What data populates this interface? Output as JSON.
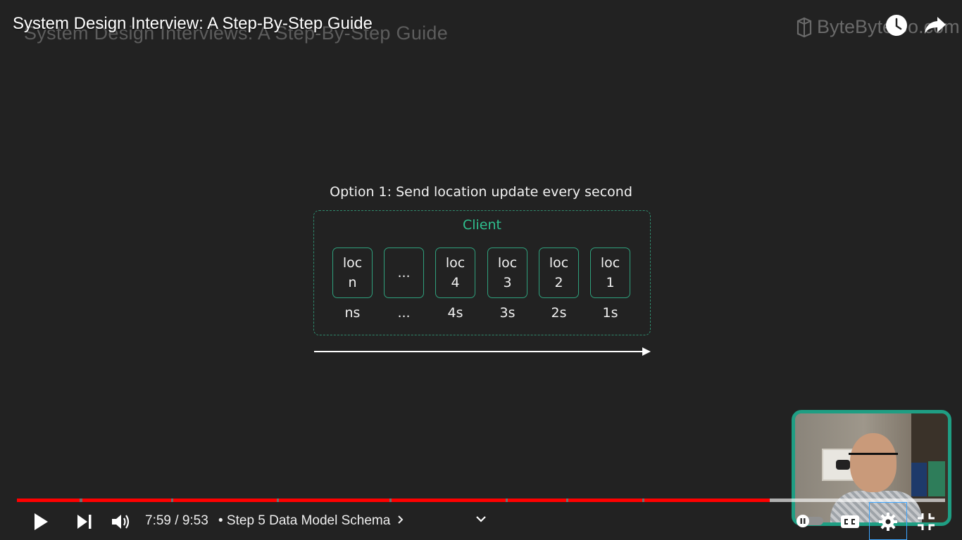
{
  "video": {
    "title": "System Design Interview: A Step-By-Step Guide",
    "channel_brand": "ByteByteGo.com"
  },
  "slide": {
    "header": "System Design Interviews: A Step-By-Step Guide",
    "option_title": "Option 1: Send location update every second",
    "client_label": "Client",
    "boxes": [
      {
        "label": "loc\nn",
        "time": "ns"
      },
      {
        "label": "...",
        "time": "..."
      },
      {
        "label": "loc\n4",
        "time": "4s"
      },
      {
        "label": "loc\n3",
        "time": "3s"
      },
      {
        "label": "loc\n2",
        "time": "2s"
      },
      {
        "label": "loc\n1",
        "time": "1s"
      }
    ],
    "accent_color": "#2fbf8e"
  },
  "player": {
    "current_time": "7:59",
    "duration": "9:53",
    "time_display": "7:59 / 9:53",
    "chapter": "• Step 5 Data Model Schema",
    "progress_fraction": 0.808,
    "progress_color": "#ff0000",
    "icons": {
      "play": "play-icon",
      "next": "next-icon",
      "volume": "volume-icon",
      "chevron": "chevron-down-icon",
      "autoplay": "autoplay-toggle-icon",
      "captions": "captions-icon",
      "settings": "gear-icon",
      "exit_fullscreen": "exit-fullscreen-icon",
      "watch_later": "clock-icon",
      "share": "share-icon"
    }
  }
}
